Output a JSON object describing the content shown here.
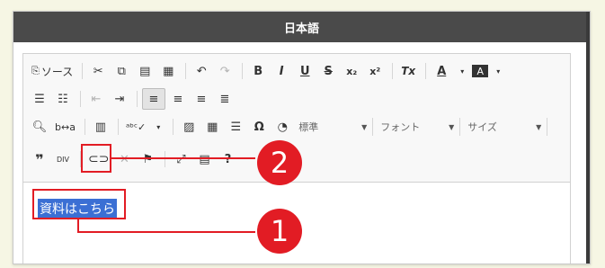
{
  "header": {
    "title": "日本語"
  },
  "toolbar": {
    "row1": {
      "source": "ソース",
      "bold": "B",
      "italic": "I",
      "underline": "U",
      "strike": "S",
      "subscript": "x₂",
      "superscript": "x²",
      "remove_format": "Tx",
      "text_color": "A",
      "bg_color": "A"
    },
    "row3": {
      "format_label": "標準",
      "font_label": "フォント",
      "size_label": "サイズ",
      "omega": "Ω"
    },
    "row4": {
      "quote": "❞",
      "div": "DIV",
      "help": "?"
    }
  },
  "editor": {
    "selected_text": "資料はこちら"
  },
  "callouts": {
    "one": "1",
    "two": "2"
  },
  "colors": {
    "accent_red": "#e21c24",
    "header_bg": "#4a4a4a",
    "selection_bg": "#3b6fd4"
  }
}
